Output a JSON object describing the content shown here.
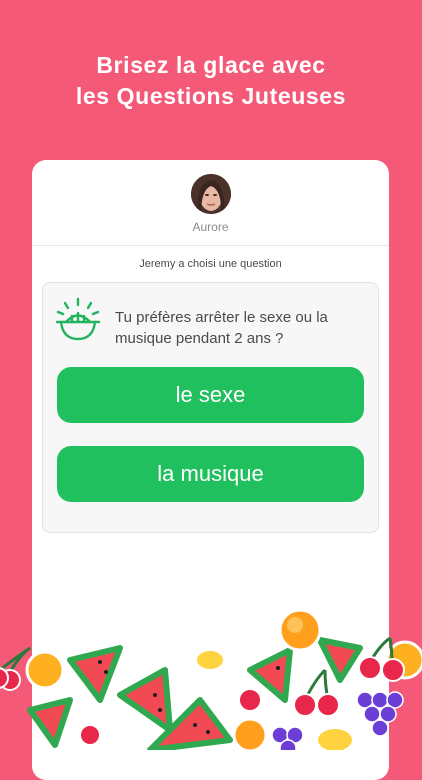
{
  "headline": {
    "line1": "Brisez la glace avec",
    "line2": "les Questions Juteuses"
  },
  "profile": {
    "name": "Aurore"
  },
  "notice": "Jeremy a choisi une question",
  "question": {
    "icon": "juicer-icon",
    "text": "Tu préfères arrêter le sexe ou la musique pendant 2 ans ?"
  },
  "answers": [
    {
      "label": "le sexe"
    },
    {
      "label": "la musique"
    }
  ],
  "colors": {
    "background": "#f45977",
    "answer_button": "#21c05e",
    "icon_green": "#22b35c"
  },
  "decoration": "fruit-pattern"
}
